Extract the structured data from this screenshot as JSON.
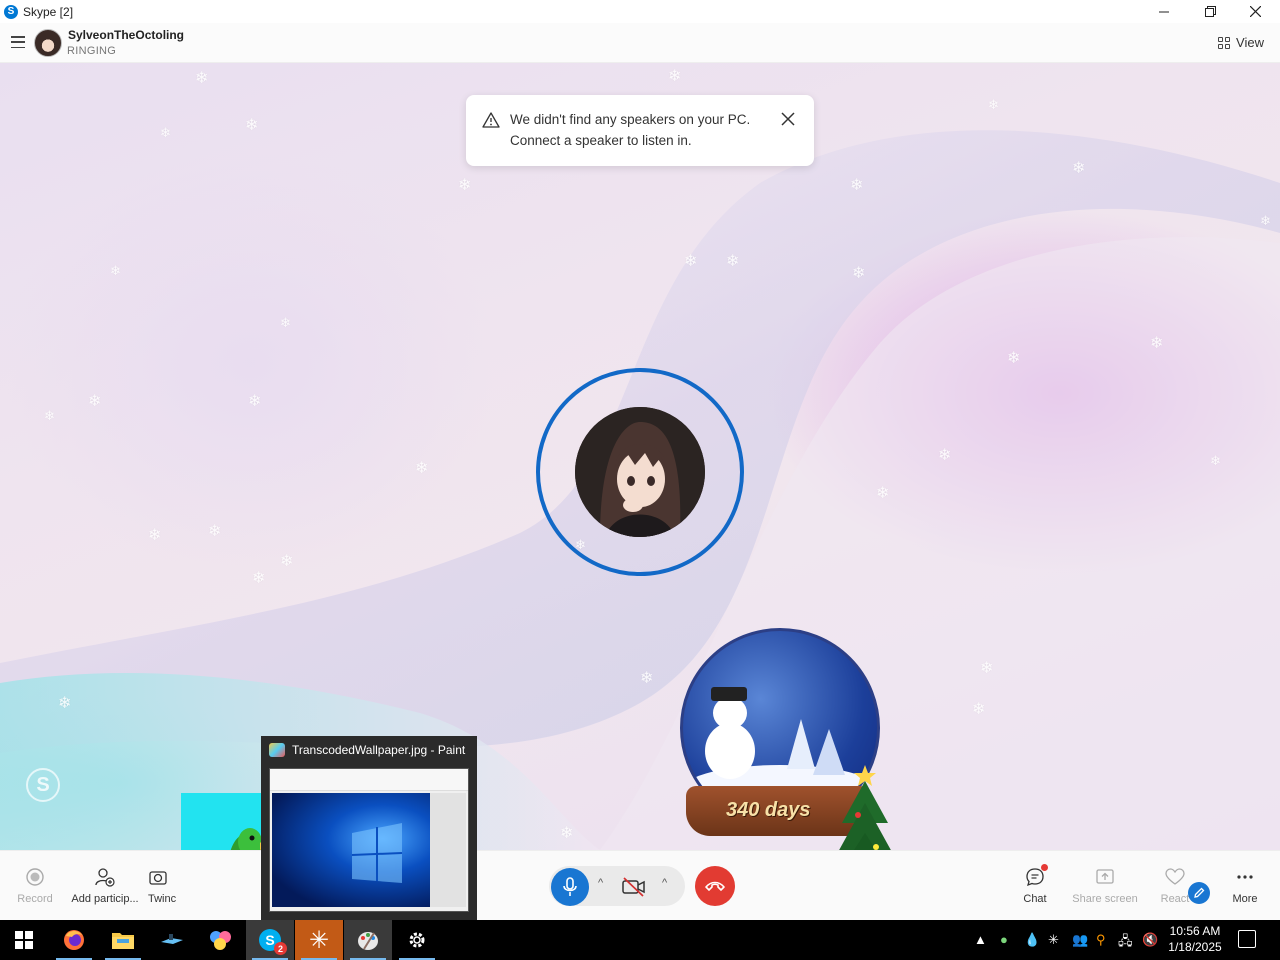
{
  "window": {
    "title": "Skype [2]",
    "app_icon": "skype-logo",
    "controls": [
      "minimize-icon",
      "restore-icon",
      "close-icon"
    ]
  },
  "call_header": {
    "contact_name": "SylveonTheOctoling",
    "status": "RINGING",
    "view_label": "View"
  },
  "toast": {
    "line1": "We didn't find any speakers on your PC.",
    "line2": "Connect a speaker to listen in."
  },
  "snow_globe": {
    "days_label": "340 days"
  },
  "controls": {
    "record": "Record",
    "add_participants": "Add particip...",
    "twin": "Twinc",
    "chat": "Chat",
    "share_screen": "Share screen",
    "react": "React",
    "more": "More"
  },
  "taskbar_preview": {
    "title": "TranscodedWallpaper.jpg - Paint"
  },
  "taskbar": {
    "apps": [
      "windows-start",
      "firefox",
      "file-explorer",
      "steam",
      "paint-3d",
      "skype",
      "snowflake-app",
      "paint",
      "settings"
    ],
    "skype_badge": "2",
    "time": "10:56 AM",
    "date": "1/18/2025"
  },
  "colors": {
    "accent": "#1976d2",
    "end_call": "#e23b32",
    "ring": "#1269c7"
  }
}
